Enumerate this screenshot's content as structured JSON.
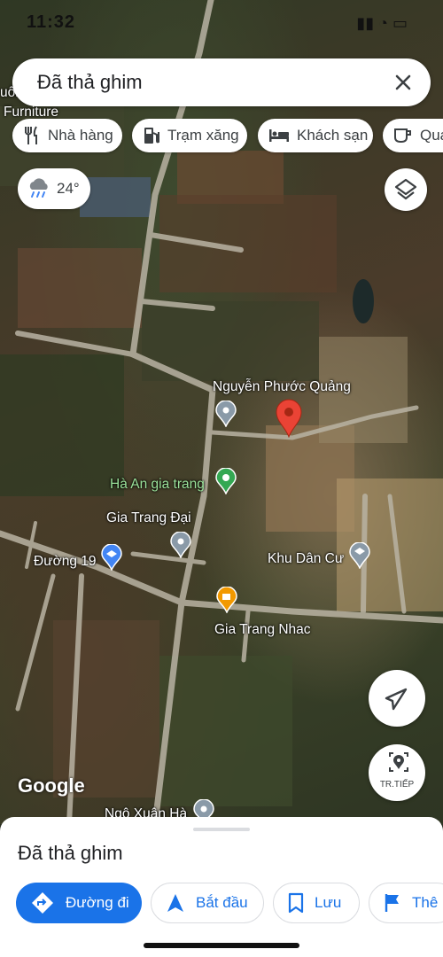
{
  "status_bar": {
    "time": "11:32",
    "icons": "signal wifi battery"
  },
  "search": {
    "title": "Đã thả ghim",
    "close_icon": "close-icon"
  },
  "chips": [
    {
      "label": "Nhà hàng",
      "icon": "restaurant-icon"
    },
    {
      "label": "Trạm xăng",
      "icon": "gas-station-icon"
    },
    {
      "label": "Khách sạn",
      "icon": "hotel-icon"
    },
    {
      "label": "Quá",
      "icon": "coffee-icon"
    }
  ],
  "weather": {
    "temp": "24°",
    "icon": "rain-cloud-icon"
  },
  "map": {
    "labels": {
      "furniture_top": "uối",
      "furniture": "Furniture",
      "pin": "Nguyễn Phước Quảng",
      "ha_an": "Hà An gia trang",
      "gia_trang_dai": "Gia Trang Đại",
      "duong19": "Đường 19",
      "khu_dan_cu": "Khu Dân Cư",
      "gia_trang_nhac": "Gia Trang Nhac",
      "ngo_xuan_ha": "Ngô Xuân Hà"
    },
    "google": "Google",
    "transit_label": "TR.TIẾP",
    "pin_color": "#ea4335"
  },
  "sheet": {
    "title": "Đã thả ghim",
    "actions": [
      {
        "label": "Đường đi",
        "icon": "directions-icon"
      },
      {
        "label": "Bắt đầu",
        "icon": "navigation-icon"
      },
      {
        "label": "Lưu",
        "icon": "bookmark-icon"
      },
      {
        "label": "Thê",
        "icon": "flag-icon"
      }
    ]
  },
  "colors": {
    "accent": "#1a73e8",
    "road": "#b9b3a3"
  }
}
